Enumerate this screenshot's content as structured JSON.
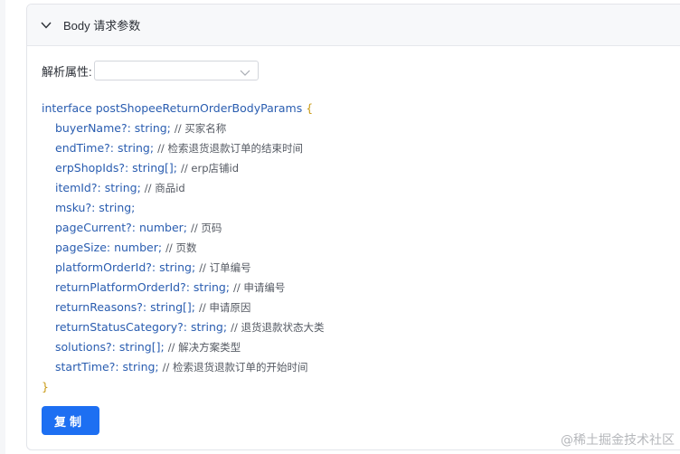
{
  "panel": {
    "title": "Body 请求参数"
  },
  "attr": {
    "label": "解析属性:",
    "selected": ""
  },
  "code": {
    "interface_kw": "interface",
    "interface_name": "postShopeeReturnOrderBodyParams",
    "open_brace": "{",
    "close_brace": "}",
    "fields": [
      {
        "name": "buyerName?:",
        "type": "string;",
        "comment": "// 买家名称"
      },
      {
        "name": "endTime?:",
        "type": "string;",
        "comment": "// 检索退货退款订单的结束时间"
      },
      {
        "name": "erpShopIds?:",
        "type": "string[];",
        "comment": "// erp店铺id"
      },
      {
        "name": "itemId?:",
        "type": "string;",
        "comment": "// 商品id"
      },
      {
        "name": "msku?:",
        "type": "string;",
        "comment": ""
      },
      {
        "name": "pageCurrent?:",
        "type": "number;",
        "comment": "// 页码"
      },
      {
        "name": "pageSize:",
        "type": "number;",
        "comment": "// 页数"
      },
      {
        "name": "platformOrderId?:",
        "type": "string;",
        "comment": "// 订单编号"
      },
      {
        "name": "returnPlatformOrderId?:",
        "type": "string;",
        "comment": "// 申请编号"
      },
      {
        "name": "returnReasons?:",
        "type": "string[];",
        "comment": "// 申请原因"
      },
      {
        "name": "returnStatusCategory?:",
        "type": "string;",
        "comment": "// 退货退款状态大类"
      },
      {
        "name": "solutions?:",
        "type": "string[];",
        "comment": "// 解决方案类型"
      },
      {
        "name": "startTime?:",
        "type": "string;",
        "comment": "// 检索退货退款订单的开始时间"
      }
    ]
  },
  "copy_button": {
    "label": "复制"
  },
  "watermark": "@稀土掘金技术社区",
  "icons": {
    "collapse": "chevron-down-icon",
    "select_arrow": "chevron-down-icon"
  },
  "colors": {
    "accent": "#1d6ff2",
    "code_blue": "#2a5db0",
    "brace": "#c99a14"
  }
}
